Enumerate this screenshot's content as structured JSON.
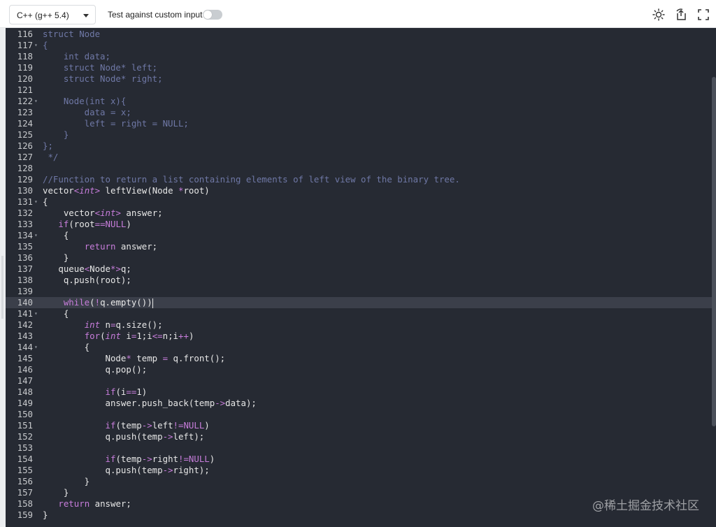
{
  "toolbar": {
    "language": "C++ (g++ 5.4)",
    "custom_input_label": "Test against custom input",
    "icons": [
      "theme-icon",
      "reset-icon",
      "fullscreen-icon"
    ]
  },
  "editor": {
    "lines": [
      {
        "n": "116",
        "fold": "",
        "segs": [
          [
            "dim",
            "struct Node"
          ]
        ]
      },
      {
        "n": "117",
        "fold": "▾",
        "segs": [
          [
            "dim",
            "{"
          ]
        ]
      },
      {
        "n": "118",
        "fold": "",
        "segs": [
          [
            "dim",
            "    int data;"
          ]
        ]
      },
      {
        "n": "119",
        "fold": "",
        "segs": [
          [
            "dim",
            "    struct Node* left;"
          ]
        ]
      },
      {
        "n": "120",
        "fold": "",
        "segs": [
          [
            "dim",
            "    struct Node* right;"
          ]
        ]
      },
      {
        "n": "121",
        "fold": "",
        "segs": []
      },
      {
        "n": "122",
        "fold": "▾",
        "segs": [
          [
            "dim",
            "    Node(int x){"
          ]
        ]
      },
      {
        "n": "123",
        "fold": "",
        "segs": [
          [
            "dim",
            "        data = x;"
          ]
        ]
      },
      {
        "n": "124",
        "fold": "",
        "segs": [
          [
            "dim",
            "        left = right = NULL;"
          ]
        ]
      },
      {
        "n": "125",
        "fold": "",
        "segs": [
          [
            "dim",
            "    }"
          ]
        ]
      },
      {
        "n": "126",
        "fold": "",
        "segs": [
          [
            "dim",
            "};"
          ]
        ]
      },
      {
        "n": "127",
        "fold": "",
        "segs": [
          [
            "dim",
            " */"
          ]
        ]
      },
      {
        "n": "128",
        "fold": "",
        "segs": []
      },
      {
        "n": "129",
        "fold": "",
        "segs": [
          [
            "cmt",
            "//Function to return a list containing elements of left view of the binary tree."
          ]
        ]
      },
      {
        "n": "130",
        "fold": "",
        "segs": [
          [
            "tx",
            "vector"
          ],
          [
            "op",
            "<"
          ],
          [
            "type",
            "int"
          ],
          [
            "op",
            ">"
          ],
          [
            "tx",
            " leftView(Node "
          ],
          [
            "op",
            "*"
          ],
          [
            "tx",
            "root)"
          ]
        ]
      },
      {
        "n": "131",
        "fold": "▾",
        "segs": [
          [
            "tx",
            "{"
          ]
        ]
      },
      {
        "n": "132",
        "fold": "",
        "segs": [
          [
            "tx",
            "    vector"
          ],
          [
            "op",
            "<"
          ],
          [
            "type",
            "int"
          ],
          [
            "op",
            ">"
          ],
          [
            "tx",
            " answer;"
          ]
        ]
      },
      {
        "n": "133",
        "fold": "",
        "segs": [
          [
            "tx",
            "   "
          ],
          [
            "kw",
            "if"
          ],
          [
            "tx",
            "(root"
          ],
          [
            "op",
            "=="
          ],
          [
            "kw",
            "NULL"
          ],
          [
            "tx",
            ")"
          ]
        ]
      },
      {
        "n": "134",
        "fold": "▾",
        "segs": [
          [
            "tx",
            "    {"
          ]
        ]
      },
      {
        "n": "135",
        "fold": "",
        "segs": [
          [
            "tx",
            "        "
          ],
          [
            "kw",
            "return"
          ],
          [
            "tx",
            " answer;"
          ]
        ]
      },
      {
        "n": "136",
        "fold": "",
        "segs": [
          [
            "tx",
            "    }"
          ]
        ]
      },
      {
        "n": "137",
        "fold": "",
        "segs": [
          [
            "tx",
            "   queue"
          ],
          [
            "op",
            "<"
          ],
          [
            "tx",
            "Node"
          ],
          [
            "op",
            "*>"
          ],
          [
            "tx",
            "q;"
          ]
        ]
      },
      {
        "n": "138",
        "fold": "",
        "segs": [
          [
            "tx",
            "    q.push(root);"
          ]
        ]
      },
      {
        "n": "139",
        "fold": "",
        "segs": []
      },
      {
        "n": "140",
        "fold": "",
        "active": true,
        "segs": [
          [
            "tx",
            "    "
          ],
          [
            "kw",
            "while"
          ],
          [
            "tx",
            "("
          ],
          [
            "op",
            "!"
          ],
          [
            "tx",
            "q.empty())"
          ]
        ]
      },
      {
        "n": "141",
        "fold": "▾",
        "segs": [
          [
            "tx",
            "    {"
          ]
        ]
      },
      {
        "n": "142",
        "fold": "",
        "segs": [
          [
            "tx",
            "        "
          ],
          [
            "type",
            "int"
          ],
          [
            "tx",
            " n"
          ],
          [
            "op",
            "="
          ],
          [
            "tx",
            "q.size();"
          ]
        ]
      },
      {
        "n": "143",
        "fold": "",
        "segs": [
          [
            "tx",
            "        "
          ],
          [
            "kw",
            "for"
          ],
          [
            "tx",
            "("
          ],
          [
            "type",
            "int"
          ],
          [
            "tx",
            " i"
          ],
          [
            "op",
            "="
          ],
          [
            "tx",
            "1;i"
          ],
          [
            "op",
            "<="
          ],
          [
            "tx",
            "n;i"
          ],
          [
            "op",
            "++"
          ],
          [
            "tx",
            ")"
          ]
        ]
      },
      {
        "n": "144",
        "fold": "▾",
        "segs": [
          [
            "tx",
            "        {"
          ]
        ]
      },
      {
        "n": "145",
        "fold": "",
        "segs": [
          [
            "tx",
            "            Node"
          ],
          [
            "op",
            "*"
          ],
          [
            "tx",
            " temp "
          ],
          [
            "op",
            "="
          ],
          [
            "tx",
            " q.front();"
          ]
        ]
      },
      {
        "n": "146",
        "fold": "",
        "segs": [
          [
            "tx",
            "            q.pop();"
          ]
        ]
      },
      {
        "n": "147",
        "fold": "",
        "segs": []
      },
      {
        "n": "148",
        "fold": "",
        "segs": [
          [
            "tx",
            "            "
          ],
          [
            "kw",
            "if"
          ],
          [
            "tx",
            "(i"
          ],
          [
            "op",
            "=="
          ],
          [
            "tx",
            "1)"
          ]
        ]
      },
      {
        "n": "149",
        "fold": "",
        "segs": [
          [
            "tx",
            "            answer.push_back(temp"
          ],
          [
            "op",
            "->"
          ],
          [
            "tx",
            "data);"
          ]
        ]
      },
      {
        "n": "150",
        "fold": "",
        "segs": []
      },
      {
        "n": "151",
        "fold": "",
        "segs": [
          [
            "tx",
            "            "
          ],
          [
            "kw",
            "if"
          ],
          [
            "tx",
            "(temp"
          ],
          [
            "op",
            "->"
          ],
          [
            "tx",
            "left"
          ],
          [
            "op",
            "!="
          ],
          [
            "kw",
            "NULL"
          ],
          [
            "tx",
            ")"
          ]
        ]
      },
      {
        "n": "152",
        "fold": "",
        "segs": [
          [
            "tx",
            "            q.push(temp"
          ],
          [
            "op",
            "->"
          ],
          [
            "tx",
            "left);"
          ]
        ]
      },
      {
        "n": "153",
        "fold": "",
        "segs": []
      },
      {
        "n": "154",
        "fold": "",
        "segs": [
          [
            "tx",
            "            "
          ],
          [
            "kw",
            "if"
          ],
          [
            "tx",
            "(temp"
          ],
          [
            "op",
            "->"
          ],
          [
            "tx",
            "right"
          ],
          [
            "op",
            "!="
          ],
          [
            "kw",
            "NULL"
          ],
          [
            "tx",
            ")"
          ]
        ]
      },
      {
        "n": "155",
        "fold": "",
        "segs": [
          [
            "tx",
            "            q.push(temp"
          ],
          [
            "op",
            "->"
          ],
          [
            "tx",
            "right);"
          ]
        ]
      },
      {
        "n": "156",
        "fold": "",
        "segs": [
          [
            "tx",
            "        }"
          ]
        ]
      },
      {
        "n": "157",
        "fold": "",
        "segs": [
          [
            "tx",
            "    }"
          ]
        ]
      },
      {
        "n": "158",
        "fold": "",
        "segs": [
          [
            "tx",
            "   "
          ],
          [
            "kw",
            "return"
          ],
          [
            "tx",
            " answer;"
          ]
        ]
      },
      {
        "n": "159",
        "fold": "",
        "segs": [
          [
            "tx",
            "}"
          ]
        ]
      }
    ]
  },
  "watermark": "@稀土掘金技术社区"
}
